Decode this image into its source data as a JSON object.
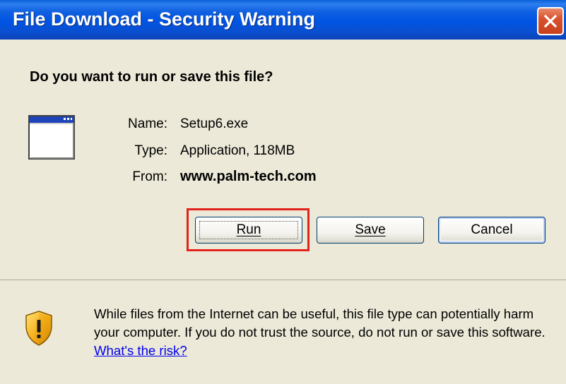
{
  "window": {
    "title": "File Download - Security Warning"
  },
  "dialog": {
    "question": "Do you want to run or save this file?",
    "fields": {
      "name_label": "Name:",
      "name_value": "Setup6.exe",
      "type_label": "Type:",
      "type_value": "Application, 118MB",
      "from_label": "From:",
      "from_value": "www.palm-tech.com"
    },
    "buttons": {
      "run": "Run",
      "save": "Save",
      "cancel": "Cancel"
    },
    "warning": {
      "text": "While files from the Internet can be useful, this file type can potentially harm your computer. If you do not trust the source, do not run or save this software.",
      "link": "What's the risk?"
    }
  },
  "icons": {
    "close": "close-icon",
    "app": "application-icon",
    "shield": "security-shield-icon"
  },
  "colors": {
    "titlebar": "#0054e3",
    "close_button": "#d8532d",
    "dialog_background": "#ece9d8",
    "highlight": "#e2231a",
    "link": "#0000ee"
  }
}
